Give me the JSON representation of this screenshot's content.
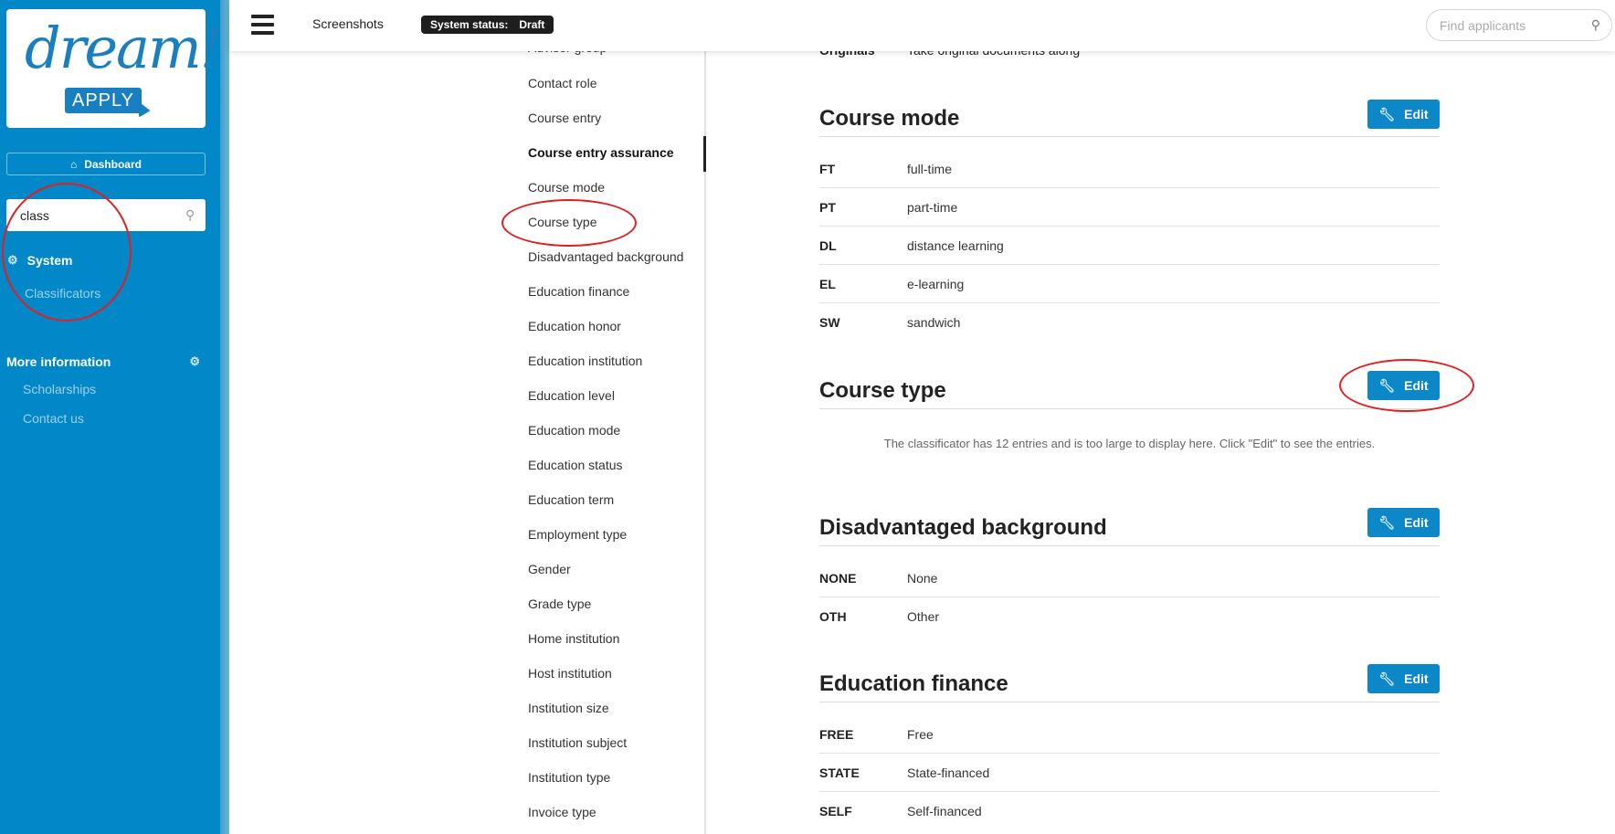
{
  "sidebar": {
    "logo_text": "dream!",
    "logo_sub": "APPLY",
    "dashboard_label": "Dashboard",
    "search_value": "class",
    "system_label": "System",
    "classificators_label": "Classificators",
    "more_info_label": "More information",
    "more_info_items": [
      "Scholarships",
      "Contact us"
    ]
  },
  "header": {
    "title": "Screenshots",
    "status_label": "System status:",
    "status_value": "Draft",
    "find_placeholder": "Find applicants"
  },
  "nav": {
    "items": [
      "Advisor group",
      "Contact role",
      "Course entry",
      "Course entry assurance",
      "Course mode",
      "Course type",
      "Disadvantaged background",
      "Education finance",
      "Education honor",
      "Education institution",
      "Education level",
      "Education mode",
      "Education status",
      "Education term",
      "Employment type",
      "Gender",
      "Grade type",
      "Home institution",
      "Host institution",
      "Institution size",
      "Institution subject",
      "Institution type",
      "Invoice type"
    ],
    "active": "Course entry assurance"
  },
  "content": {
    "edit_label": "Edit",
    "originals": {
      "code": "Originals",
      "value": "Take original documents along"
    },
    "sections": [
      {
        "title": "Course mode",
        "rows": [
          {
            "code": "FT",
            "value": "full-time"
          },
          {
            "code": "PT",
            "value": "part-time"
          },
          {
            "code": "DL",
            "value": "distance learning"
          },
          {
            "code": "EL",
            "value": "e-learning"
          },
          {
            "code": "SW",
            "value": "sandwich"
          }
        ]
      },
      {
        "title": "Course type",
        "note": "The classificator has 12 entries and is too large to display here. Click \"Edit\" to see the entries."
      },
      {
        "title": "Disadvantaged background",
        "rows": [
          {
            "code": "NONE",
            "value": "None"
          },
          {
            "code": "OTH",
            "value": "Other"
          }
        ]
      },
      {
        "title": "Education finance",
        "rows": [
          {
            "code": "FREE",
            "value": "Free"
          },
          {
            "code": "STATE",
            "value": "State-financed"
          },
          {
            "code": "SELF",
            "value": "Self-financed"
          }
        ]
      }
    ]
  },
  "colors": {
    "sidebar_bg": "#0288c9",
    "accent": "#0c87c8",
    "annotation": "#e02020",
    "badge_bg": "#1e1e1e"
  },
  "icons": {
    "dashboard": "home-icon",
    "search": "search-icon",
    "system": "gear-icon",
    "edit": "wrench-icon",
    "menu": "hamburger-icon"
  }
}
